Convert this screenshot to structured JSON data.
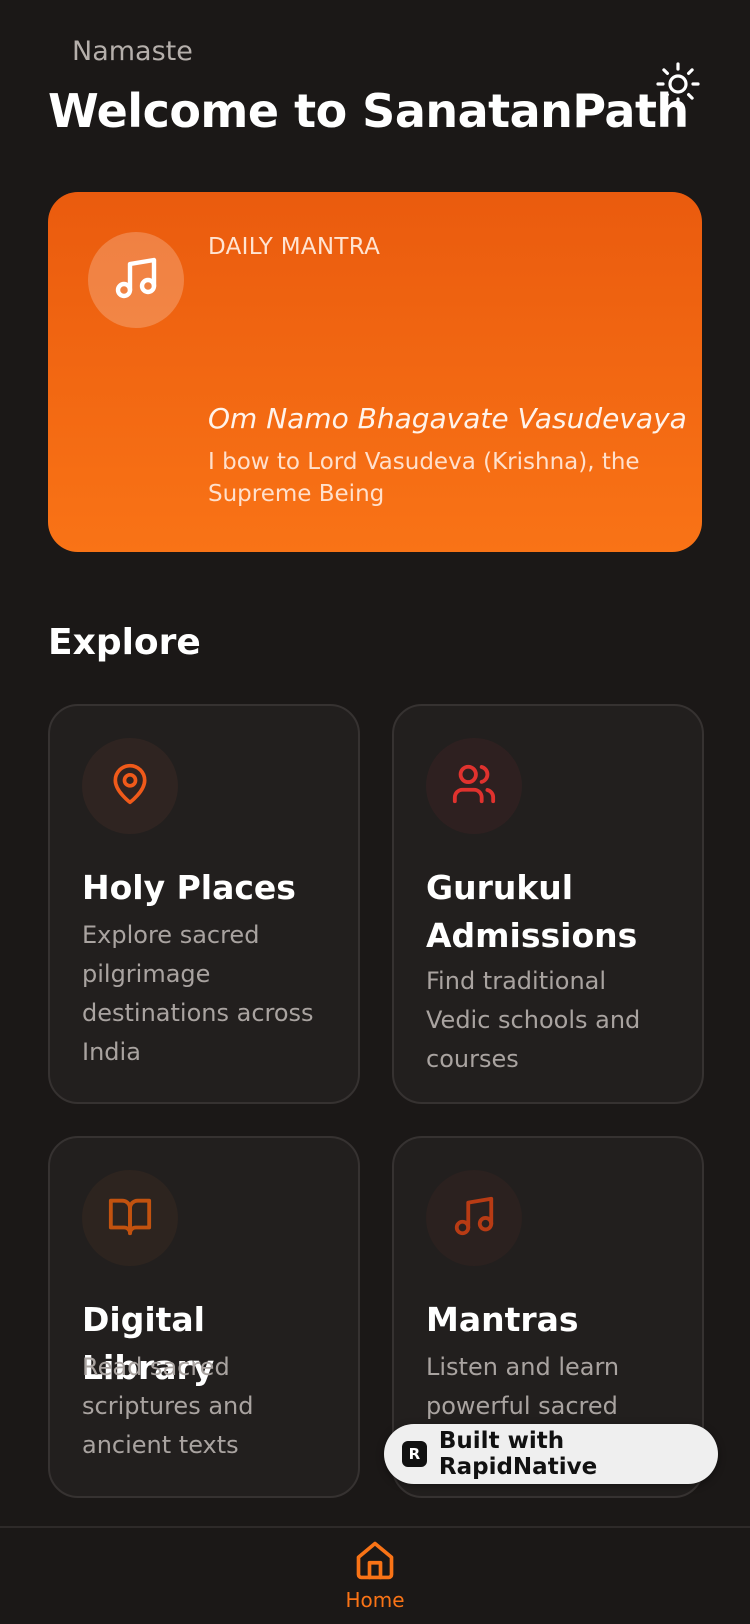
{
  "header": {
    "greeting": "Namaste",
    "title": "Welcome to SanatanPath",
    "theme_icon": "sun-icon"
  },
  "daily_mantra": {
    "label": "DAILY MANTRA",
    "icon": "music-note-icon",
    "mantra": "Om Namo Bhagavate Vasudevaya",
    "meaning": "I bow to Lord Vasudeva (Krishna), the Supreme Being"
  },
  "explore": {
    "title": "Explore",
    "cards": [
      {
        "title": "Holy Places",
        "description": "Explore sacred pilgrimage destinations across India",
        "icon": "map-pin-icon"
      },
      {
        "title": "Gurukul Admissions",
        "description": "Find traditional Vedic schools and courses",
        "icon": "users-icon"
      },
      {
        "title": "Digital Library",
        "description": "Read sacred scriptures and ancient texts",
        "icon": "book-open-icon"
      },
      {
        "title": "Mantras",
        "description": "Listen and learn powerful sacred",
        "icon": "music-note-icon"
      }
    ]
  },
  "badge": {
    "text": "Built with RapidNative",
    "logo_letter": "R"
  },
  "tab_bar": {
    "home_label": "Home",
    "home_icon": "home-icon"
  },
  "colors": {
    "background": "#1b1817",
    "accent": "#f97316",
    "card": "#221f1e",
    "pin": "#f05a1a",
    "users": "#e0322e",
    "book": "#c2520f",
    "music": "#b83b14"
  }
}
